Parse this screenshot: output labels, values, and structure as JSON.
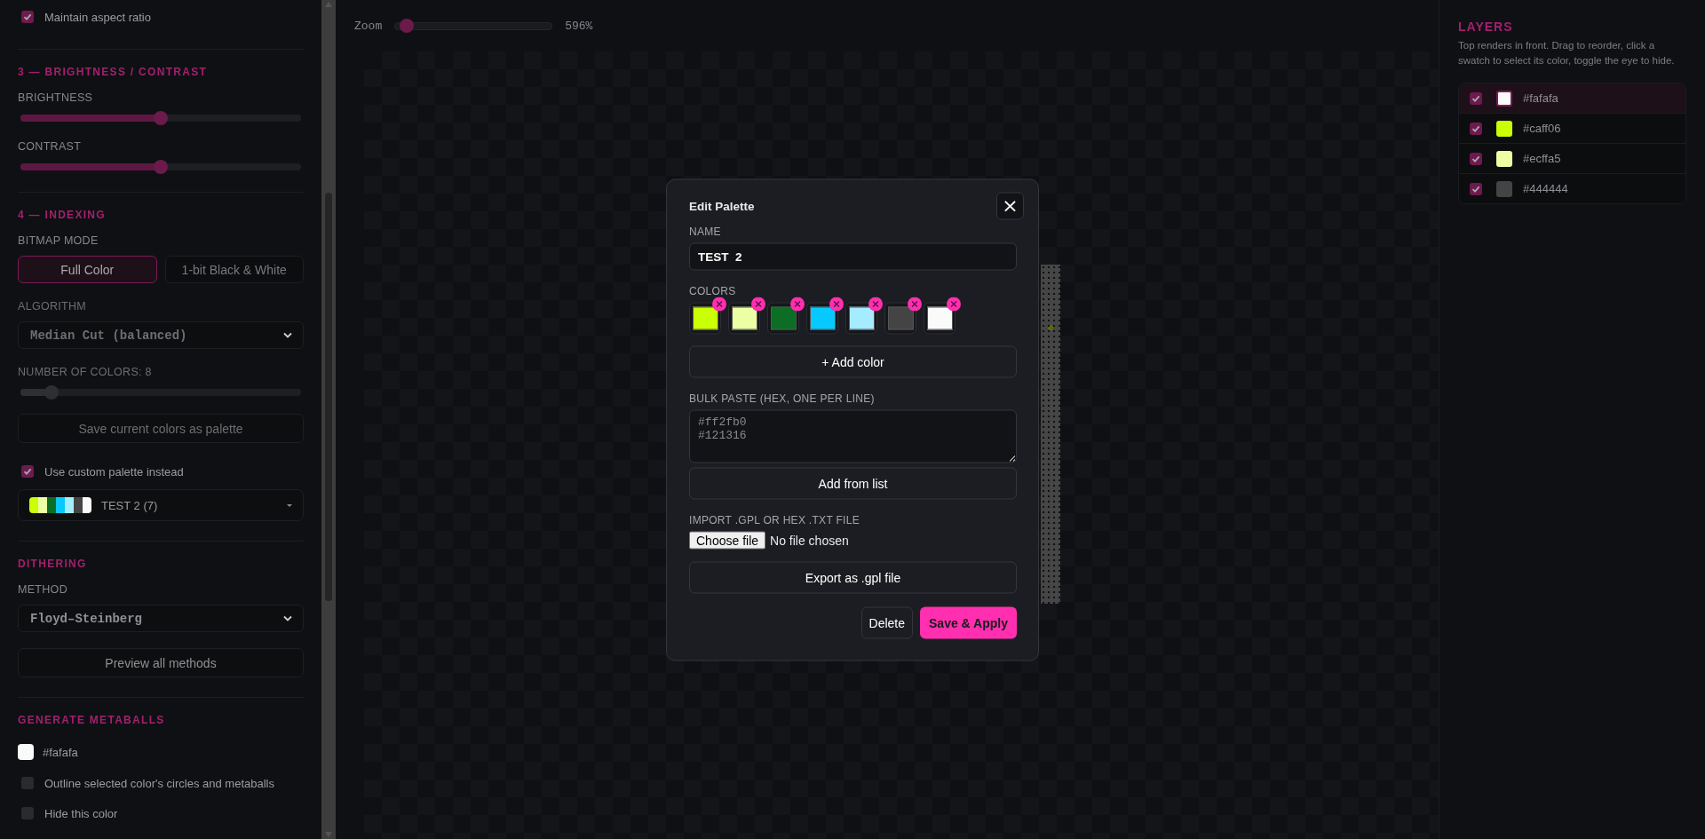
{
  "sidebar": {
    "aspect_ratio": {
      "label": "Maintain aspect ratio",
      "checked": true
    },
    "sections": [
      {
        "title": "3 — BRIGHTNESS / CONTRAST",
        "items": [
          {
            "kind": "slider",
            "label": "BRIGHTNESS",
            "level": 0.5,
            "disabled": false
          },
          {
            "kind": "slider",
            "label": "CONTRAST",
            "level": 0.5,
            "disabled": false
          }
        ]
      },
      {
        "title": "4 — INDEXING",
        "items": [
          {
            "kind": "segmented",
            "label": "BITMAP MODE",
            "options": [
              {
                "label": "Full Color",
                "selected": true
              },
              {
                "label": "1-bit Black & White",
                "selected": false
              }
            ]
          },
          {
            "kind": "select",
            "label": "ALGORITHM",
            "value": "Median Cut (balanced)",
            "disabled": true
          },
          {
            "kind": "slider",
            "label": "NUMBER OF COLORS: 8",
            "level": 0.11,
            "disabled": true
          },
          {
            "kind": "button",
            "label": "Save current colors as palette",
            "disabled": true
          },
          {
            "kind": "checkbox",
            "label": "Use custom palette instead",
            "checked": true
          },
          {
            "kind": "palette",
            "label": "TEST 2 (7)",
            "colors": [
              {
                "color": "#caff06"
              },
              {
                "color": "#ecffa5"
              },
              {
                "color": "#0b6e24"
              },
              {
                "color": "#06caff"
              },
              {
                "color": "#a5ecff"
              },
              {
                "color": "#444444"
              },
              {
                "color": "#fafafa"
              }
            ]
          }
        ]
      },
      {
        "title": "DITHERING",
        "items": [
          {
            "kind": "select",
            "label": "METHOD",
            "value": "Floyd–Steinberg",
            "disabled": false
          },
          {
            "kind": "button",
            "label": "Preview all methods",
            "disabled": false
          }
        ]
      },
      {
        "title": "GENERATE METABALLS",
        "items": [
          {
            "kind": "color",
            "label": "#fafafa",
            "color": "#fafafa"
          },
          {
            "kind": "checkbox",
            "label": "Outline selected color's circles and metaballs",
            "checked": false
          },
          {
            "kind": "checkbox",
            "label": "Hide this color",
            "checked": false
          }
        ]
      }
    ]
  },
  "zoom": {
    "label": "Zoom",
    "level": 0.075,
    "reading": "596%"
  },
  "layers": {
    "title": "LAYERS",
    "hint": "Top renders in front. Drag to reorder, click a swatch to select its color, toggle the eye to hide.",
    "rows": [
      {
        "label": "#fafafa",
        "color": "#fafafa",
        "visible": true,
        "selected": true
      },
      {
        "label": "#caff06",
        "color": "#caff06",
        "visible": true,
        "selected": false
      },
      {
        "label": "#ecffa5",
        "color": "#ecffa5",
        "visible": true,
        "selected": false
      },
      {
        "label": "#444444",
        "color": "#444444",
        "visible": true,
        "selected": false
      }
    ]
  },
  "modal": {
    "title": "Edit Palette",
    "close": "×",
    "name_label": "NAME",
    "name_value": "TEST  2",
    "colors_label": "COLORS",
    "colors": [
      {
        "color": "#caff06"
      },
      {
        "color": "#ecffa5"
      },
      {
        "color": "#0b6e24"
      },
      {
        "color": "#06caff"
      },
      {
        "color": "#a5ecff"
      },
      {
        "color": "#444444"
      },
      {
        "color": "#fafafa"
      }
    ],
    "add_color": "+ Add color",
    "bulk_label": "BULK PASTE (HEX, ONE PER LINE)",
    "bulk_placeholder": "#ff2fb0\n#121316",
    "add_from_list": "Add from list",
    "import_label": "IMPORT .GPL OR HEX .TXT FILE",
    "file_button": "Choose file",
    "file_status": "No file chosen",
    "export": "Export as .gpl file",
    "delete": "Delete",
    "save": "Save & Apply"
  }
}
